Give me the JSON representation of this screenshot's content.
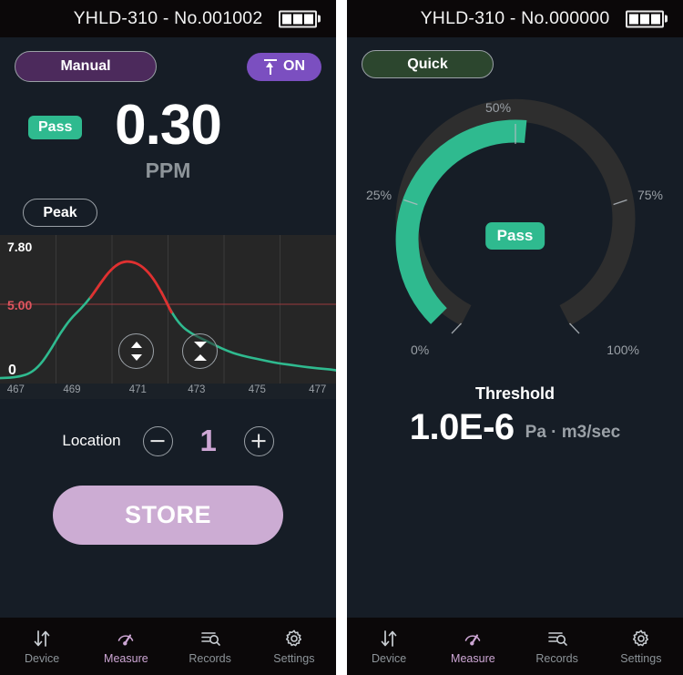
{
  "colors": {
    "accent_green": "#2fba8f",
    "accent_purple": "#7b4fc0",
    "accent_pink": "#cda6d4",
    "threshold_red": "#e0555f",
    "panel_bg": "#161d26",
    "statusbar_bg": "#0b0809",
    "chart_bg": "#262626"
  },
  "left": {
    "statusbar": {
      "title": "YHLD-310 - No.001002",
      "battery_cells": 3
    },
    "mode_button": {
      "label": "Manual"
    },
    "power_button": {
      "label": "ON",
      "icon": "upload-icon"
    },
    "reading": {
      "status": "Pass",
      "value": "0.30",
      "unit": "PPM"
    },
    "peak_button": {
      "label": "Peak"
    },
    "chart": {
      "y_top": "7.80",
      "y_threshold": "5.00",
      "y_zero": "0",
      "x_labels": [
        "467",
        "469",
        "471",
        "473",
        "475",
        "477"
      ],
      "vzoom_button": "vertical-zoom-icon",
      "hzoom_button": "horizontal-zoom-icon"
    },
    "location": {
      "label": "Location",
      "value": "1",
      "minus": "−",
      "plus": "+"
    },
    "store_button": {
      "label": "STORE"
    }
  },
  "right": {
    "statusbar": {
      "title": "YHLD-310 - No.000000",
      "battery_cells": 3
    },
    "mode_button": {
      "label": "Quick"
    },
    "gauge": {
      "status": "Pass",
      "ticks": [
        "0%",
        "25%",
        "50%",
        "75%",
        "100%"
      ],
      "value_percent": 52
    },
    "threshold": {
      "title": "Threshold",
      "value": "1.0E-6",
      "unit": "Pa · m3/sec"
    }
  },
  "nav": {
    "items": [
      {
        "label": "Device",
        "icon": "transfer-arrows-icon",
        "active": false
      },
      {
        "label": "Measure",
        "icon": "gauge-icon",
        "active": true
      },
      {
        "label": "Records",
        "icon": "records-search-icon",
        "active": false
      },
      {
        "label": "Settings",
        "icon": "gear-icon",
        "active": false
      }
    ]
  },
  "chart_data": {
    "type": "line",
    "title": "",
    "xlabel": "",
    "ylabel": "",
    "xlim": [
      467,
      477
    ],
    "ylim": [
      0,
      7.8
    ],
    "threshold": 5.0,
    "grid": true,
    "legend": "none",
    "x": [
      467.0,
      467.3,
      467.6,
      467.9,
      468.2,
      468.5,
      468.8,
      469.1,
      469.4,
      469.7,
      470.0,
      470.3,
      470.6,
      470.9,
      471.2,
      471.5,
      471.8,
      472.1,
      472.4,
      472.7,
      473.0,
      473.3,
      473.6,
      473.9,
      474.2,
      474.5,
      474.8,
      475.1,
      475.4,
      475.7,
      476.0,
      476.3,
      476.6,
      476.9,
      477.0
    ],
    "y": [
      0.05,
      0.08,
      0.15,
      0.35,
      0.85,
      1.75,
      2.8,
      3.65,
      4.25,
      4.95,
      5.85,
      6.65,
      7.1,
      7.15,
      6.9,
      6.3,
      5.3,
      4.05,
      3.2,
      2.75,
      2.45,
      2.15,
      1.85,
      1.6,
      1.42,
      1.28,
      1.15,
      1.02,
      0.92,
      0.84,
      0.75,
      0.68,
      0.62,
      0.56,
      0.52
    ],
    "segments": [
      {
        "name": "below-threshold",
        "color": "#2fba8f"
      },
      {
        "name": "above-threshold",
        "color": "#e03030"
      }
    ]
  }
}
